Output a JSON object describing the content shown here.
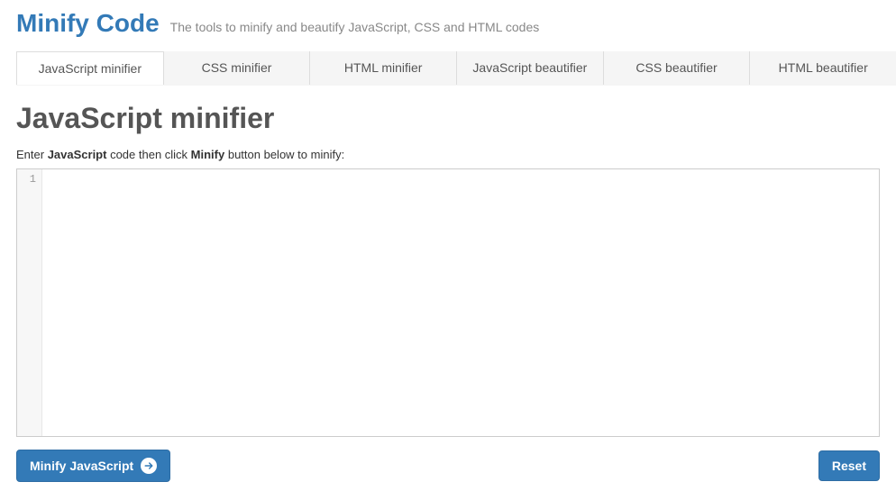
{
  "header": {
    "logo": "Minify Code",
    "tagline": "The tools to minify and beautify JavaScript, CSS and HTML codes"
  },
  "tabs": {
    "items": [
      {
        "label": "JavaScript minifier",
        "active": true
      },
      {
        "label": "CSS minifier",
        "active": false
      },
      {
        "label": "HTML minifier",
        "active": false
      },
      {
        "label": "JavaScript beautifier",
        "active": false
      },
      {
        "label": "CSS beautifier",
        "active": false
      },
      {
        "label": "HTML beautifier",
        "active": false
      }
    ]
  },
  "main": {
    "title": "JavaScript minifier",
    "instructions_prefix": "Enter ",
    "instructions_lang": "JavaScript",
    "instructions_mid": " code then click ",
    "instructions_action": "Minify",
    "instructions_suffix": " button below to minify:",
    "gutter_line": "1",
    "code_value": ""
  },
  "buttons": {
    "minify": "Minify JavaScript",
    "reset": "Reset"
  },
  "colors": {
    "primary": "#337ab7"
  }
}
